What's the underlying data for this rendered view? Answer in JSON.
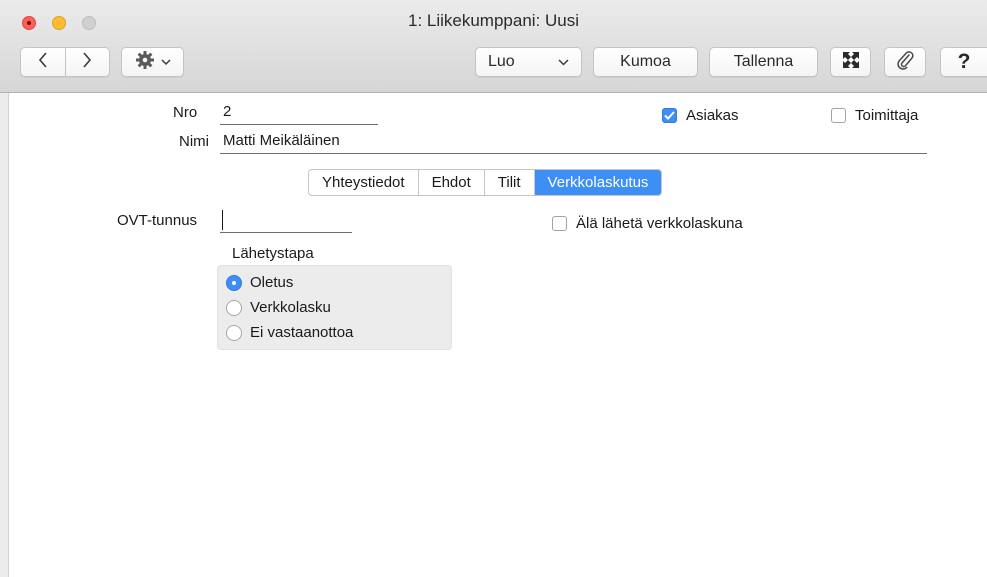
{
  "window": {
    "title": "1: Liikekumppani: Uusi"
  },
  "toolbar": {
    "back_icon": "chevron-left-icon",
    "forward_icon": "chevron-right-icon",
    "gear_icon": "gear-icon",
    "luo_label": "Luo",
    "kumoa_label": "Kumoa",
    "tallenna_label": "Tallenna",
    "expand_icon": "expand-icon",
    "attach_icon": "paperclip-icon",
    "help_label": "?"
  },
  "form": {
    "nro_label": "Nro",
    "nro_value": "2",
    "nimi_label": "Nimi",
    "nimi_value": "Matti Meikäläinen",
    "asiakas_label": "Asiakas",
    "asiakas_checked": true,
    "toimittaja_label": "Toimittaja",
    "toimittaja_checked": false
  },
  "tabs": [
    {
      "label": "Yhteystiedot",
      "active": false
    },
    {
      "label": "Ehdot",
      "active": false
    },
    {
      "label": "Tilit",
      "active": false
    },
    {
      "label": "Verkkolaskutus",
      "active": true
    }
  ],
  "verkkolaskutus": {
    "ovt_label": "OVT-tunnus",
    "ovt_value": "",
    "ala_laheta_label": "Älä lähetä verkkolaskuna",
    "ala_laheta_checked": false,
    "lahetystapa_label": "Lähetystapa",
    "options": [
      {
        "label": "Oletus",
        "selected": true
      },
      {
        "label": "Verkkolasku",
        "selected": false
      },
      {
        "label": "Ei vastaanottoa",
        "selected": false
      }
    ]
  },
  "colors": {
    "accent": "#3d8ff5"
  }
}
